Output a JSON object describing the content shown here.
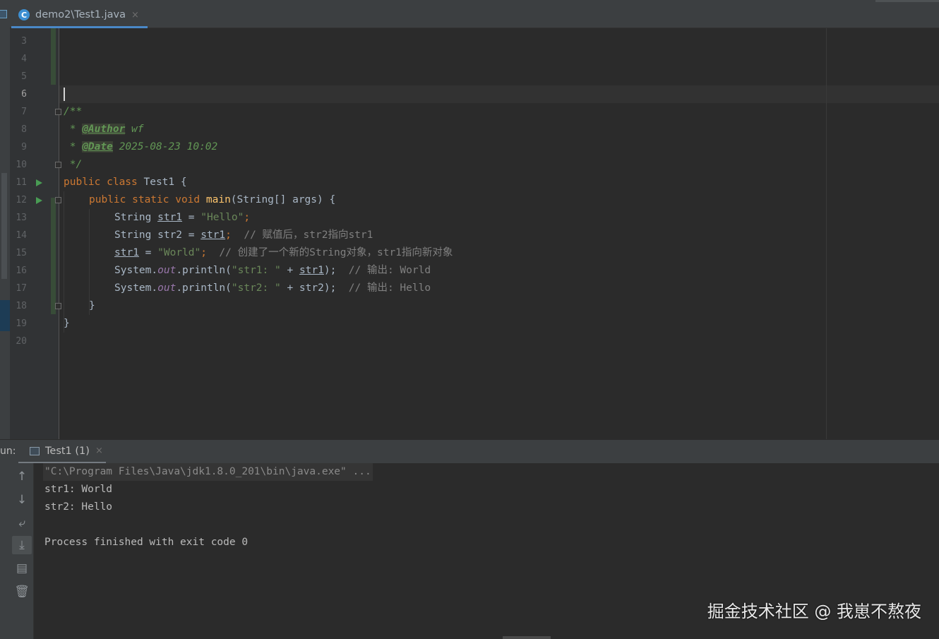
{
  "editor_tab": {
    "label": "demo2\\Test1.java",
    "icon_letter": "C",
    "close": "×"
  },
  "line_numbers": [
    "3",
    "4",
    "5",
    "6",
    "7",
    "8",
    "9",
    "10",
    "11",
    "12",
    "13",
    "14",
    "15",
    "16",
    "17",
    "18",
    "19",
    "20"
  ],
  "current_line": "6",
  "code": {
    "l7": "/**",
    "l8_star": " * ",
    "l8_tag": "@Author",
    "l8_val": " wf",
    "l9_star": " * ",
    "l9_tag": "@Date",
    "l9_val": " 2025-08-23 10:02",
    "l10": " */",
    "l11_kw": "public class",
    "l11_rest": " Test1 {",
    "l12_kw": "public static void",
    "l12_fn": "main",
    "l12_rest": "(String[] args) {",
    "l13_type": "String ",
    "l13_var": "str1",
    "l13_eq": " = ",
    "l13_str": "\"Hello\"",
    "l13_semi": ";",
    "l14_type": "String str2 = ",
    "l14_var": "str1",
    "l14_semi": ";",
    "l14_cm": "  // 赋值后，str2指向str1",
    "l15_var": "str1",
    "l15_eq": " = ",
    "l15_str": "\"World\"",
    "l15_semi": ";",
    "l15_cm": "  // 创建了一个新的String对象，str1指向新对象",
    "l16_a": "System.",
    "l16_out": "out",
    "l16_b": ".println(",
    "l16_str": "\"str1: \"",
    "l16_c": " + ",
    "l16_var": "str1",
    "l16_d": ");",
    "l16_cm": "  // 输出: World",
    "l17_a": "System.",
    "l17_out": "out",
    "l17_b": ".println(",
    "l17_str": "\"str2: \"",
    "l17_c": " + str2);",
    "l17_cm": "  // 输出: Hello",
    "l18": "}",
    "l19": "}"
  },
  "run_panel": {
    "label": "un:",
    "tab_label": "Test1 (1)",
    "close": "×",
    "output": [
      "\"C:\\Program Files\\Java\\jdk1.8.0_201\\bin\\java.exe\" ...",
      "str1: World",
      "str2: Hello",
      "",
      "Process finished with exit code 0"
    ],
    "toolbar_icons": [
      "up-arrow-icon",
      "down-arrow-icon",
      "soft-wrap-icon",
      "scroll-to-end-icon",
      "print-icon",
      "trash-icon"
    ]
  },
  "watermark": "掘金技术社区 @ 我崽不熬夜",
  "colors": {
    "accent": "#4a88c7",
    "keyword": "#cc7832",
    "string": "#6a8759",
    "comment": "#808080",
    "doc": "#629755",
    "run_green": "#499c54"
  }
}
